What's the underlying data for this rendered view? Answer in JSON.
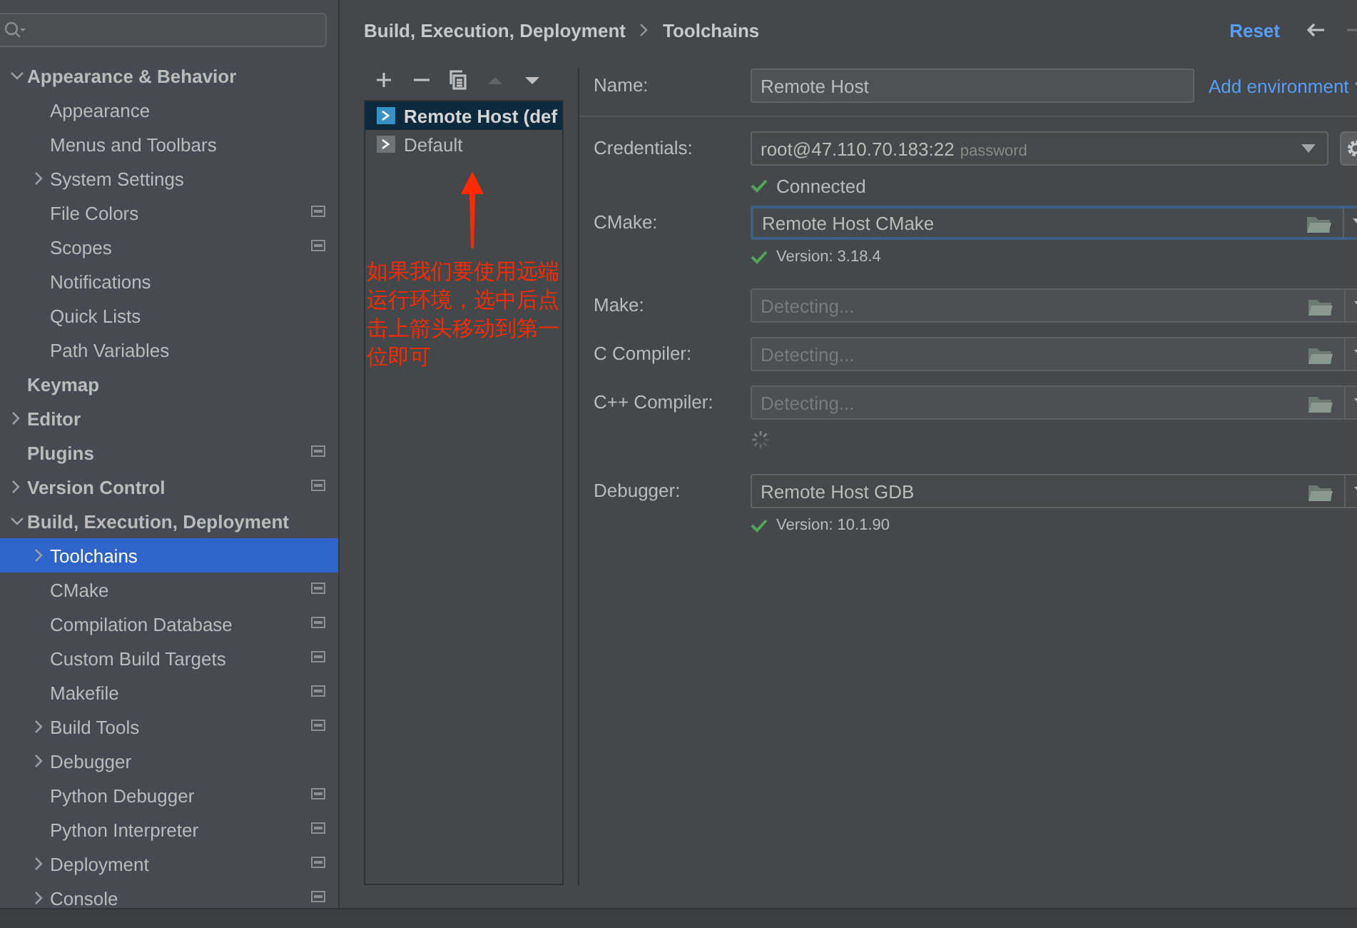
{
  "sidebar": {
    "items": [
      {
        "label": "Appearance & Behavior",
        "expanded": true,
        "badge": false,
        "selected": false,
        "children": [
          {
            "label": "Appearance",
            "badge": false,
            "selected": false
          },
          {
            "label": "Menus and Toolbars",
            "badge": false,
            "selected": false
          },
          {
            "label": "System Settings",
            "expanded": false,
            "badge": false,
            "selected": false
          },
          {
            "label": "File Colors",
            "badge": true,
            "selected": false
          },
          {
            "label": "Scopes",
            "badge": true,
            "selected": false
          },
          {
            "label": "Notifications",
            "badge": false,
            "selected": false
          },
          {
            "label": "Quick Lists",
            "badge": false,
            "selected": false
          },
          {
            "label": "Path Variables",
            "badge": false,
            "selected": false
          }
        ]
      },
      {
        "label": "Keymap",
        "badge": false,
        "selected": false
      },
      {
        "label": "Editor",
        "expanded": false,
        "badge": false,
        "selected": false
      },
      {
        "label": "Plugins",
        "badge": true,
        "selected": false
      },
      {
        "label": "Version Control",
        "expanded": false,
        "badge": true,
        "selected": false
      },
      {
        "label": "Build, Execution, Deployment",
        "expanded": true,
        "badge": false,
        "selected": false,
        "children": [
          {
            "label": "Toolchains",
            "expanded": false,
            "badge": false,
            "selected": true
          },
          {
            "label": "CMake",
            "badge": true,
            "selected": false
          },
          {
            "label": "Compilation Database",
            "badge": true,
            "selected": false
          },
          {
            "label": "Custom Build Targets",
            "badge": true,
            "selected": false
          },
          {
            "label": "Makefile",
            "badge": true,
            "selected": false
          },
          {
            "label": "Build Tools",
            "expanded": false,
            "badge": true,
            "selected": false
          },
          {
            "label": "Debugger",
            "expanded": false,
            "badge": false,
            "selected": false
          },
          {
            "label": "Python Debugger",
            "badge": true,
            "selected": false
          },
          {
            "label": "Python Interpreter",
            "badge": true,
            "selected": false
          },
          {
            "label": "Deployment",
            "expanded": false,
            "badge": true,
            "selected": false
          },
          {
            "label": "Console",
            "expanded": false,
            "badge": true,
            "selected": false
          }
        ]
      }
    ]
  },
  "header": {
    "breadcrumb": [
      "Build, Execution, Deployment",
      "Toolchains"
    ],
    "reset": "Reset",
    "back_disabled": false,
    "forward_disabled": true
  },
  "toolbar": [
    {
      "kind": "add",
      "disabled": false
    },
    {
      "kind": "remove",
      "disabled": false
    },
    {
      "kind": "copy",
      "disabled": false
    },
    {
      "kind": "up",
      "disabled": true
    },
    {
      "kind": "down",
      "disabled": false
    }
  ],
  "toolchains": [
    {
      "label": "Remote Host (def",
      "kind": "remote",
      "selected": true
    },
    {
      "label": "Default",
      "kind": "local",
      "selected": false
    }
  ],
  "form": {
    "name": {
      "label": "Name:",
      "value": "Remote Host"
    },
    "add_environment": "Add environment",
    "credentials": {
      "label": "Credentials:",
      "value": "root@47.110.70.183:22",
      "hint": "password",
      "status": "Connected"
    },
    "tools": [
      {
        "label": "CMake:",
        "value": "Remote Host CMake",
        "focused": true,
        "note": "Version: 3.18.4"
      },
      {
        "label": "Make:",
        "placeholder": "Detecting...",
        "focused": false
      },
      {
        "label": "C Compiler:",
        "placeholder": "Detecting...",
        "focused": false
      },
      {
        "label": "C++ Compiler:",
        "placeholder": "Detecting...",
        "focused": false,
        "loading": true
      },
      {
        "label": "Debugger:",
        "value": "Remote Host GDB",
        "focused": false,
        "note": "Version: 10.1.90"
      }
    ]
  },
  "annotation": {
    "text": "如果我们要使用远端运行环境，选中后点击上箭头移动到第一位即可"
  }
}
